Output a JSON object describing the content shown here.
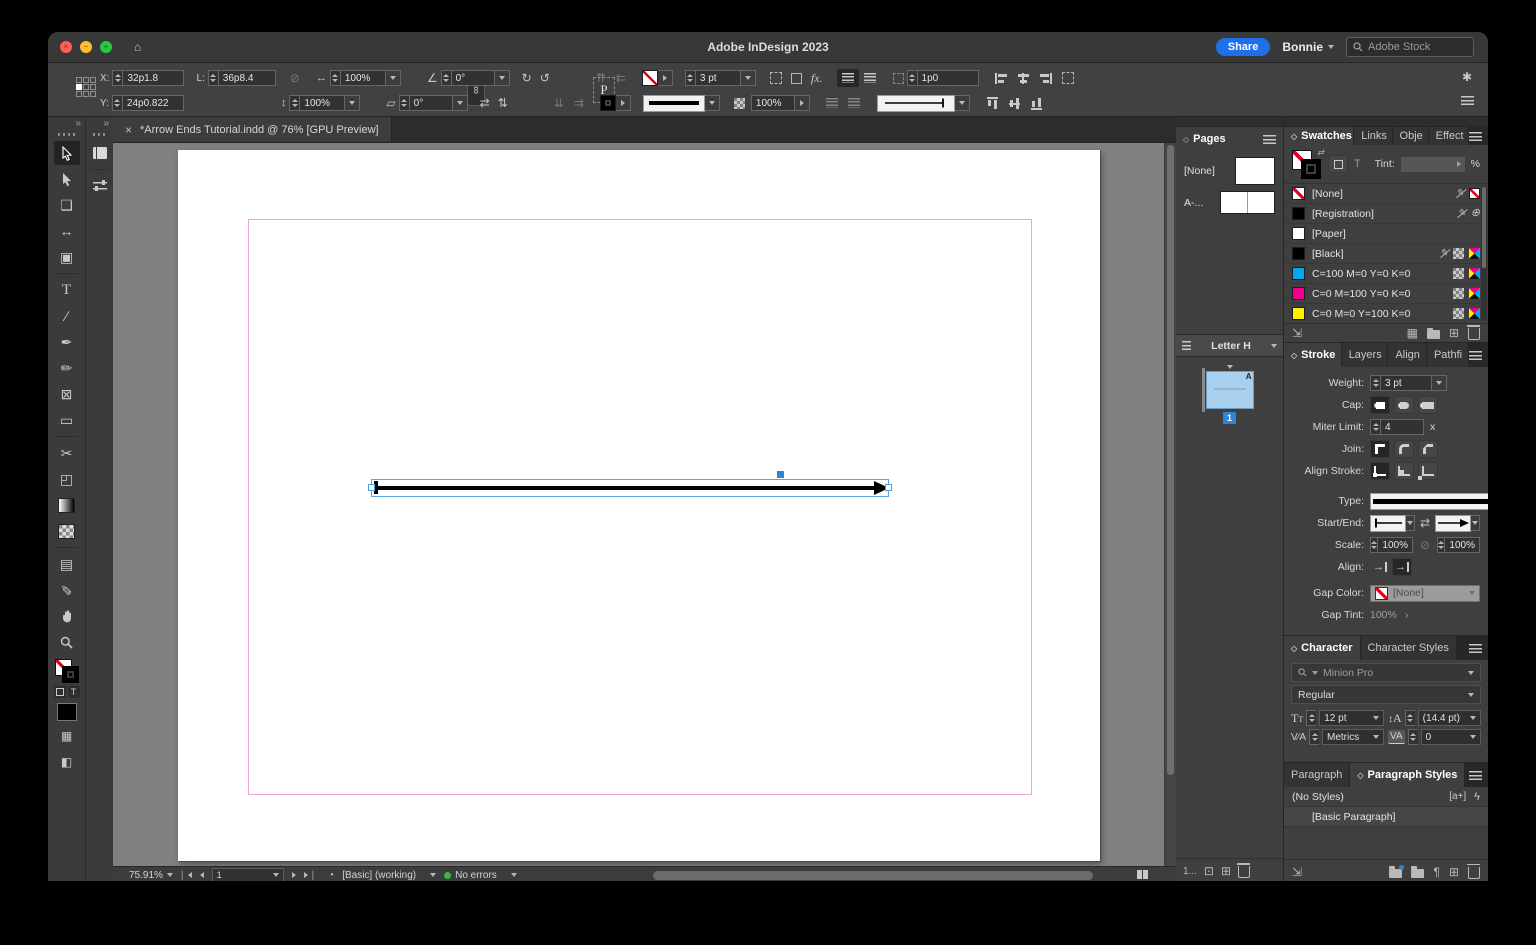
{
  "colors": {
    "accent_blue": "#1f6fe8",
    "selection_blue": "#4f9fe8",
    "margin_guide_pink": "#eba3d8",
    "error_green": "#3cb83c",
    "swatch_cyan": "#00a8ec",
    "swatch_magenta": "#ec008c",
    "swatch_yellow": "#ffef00"
  },
  "icons": {
    "home": "⌂",
    "collapse": "»",
    "panel_toggle": "◇",
    "rotate_cw": "↻",
    "rotate_ccw": "↺",
    "flip_h": "⇄",
    "flip_v": "⇅",
    "angle": "∠",
    "shear": "▱",
    "scale_h": "↔",
    "scale_v": "↕",
    "link": "∞",
    "broken_link": "⊘",
    "swap": "⇄",
    "pale_1": "⇈",
    "pale_2": "⇇",
    "pale_3": "⇊",
    "pale_4": "⇉",
    "gear": "✱",
    "more": "›",
    "tool_page": "❏",
    "tool_gap": "↔",
    "tool_collector": "▣",
    "tool_type": "T",
    "tool_line": "∕",
    "tool_pen": "✒",
    "tool_pencil": "✏",
    "tool_frame": "⊠",
    "tool_rect": "▭",
    "tool_scissors": "✂",
    "tool_freetransform": "◰",
    "tool_note": "▤",
    "tool_eyedropper": "✐",
    "tool_screenmode": "◧",
    "tool_viewopts": "▦",
    "registration": "⊕",
    "import": "⇲",
    "new_item": "⊞",
    "pilcrow": "¶",
    "bolt": "ϟ",
    "preflight": "◔",
    "fmt_text": "T"
  },
  "titlebar": {
    "title": "Adobe InDesign 2023",
    "share": "Share",
    "user": "Bonnie",
    "stock": "Adobe Stock"
  },
  "control": {
    "x_label": "X:",
    "x_value": "32p1.8",
    "y_label": "Y:",
    "y_value": "24p0.822",
    "l_label": "L:",
    "l_value": "36p8.4",
    "scale_w": "100%",
    "scale_h": "100%",
    "rotation": "0°",
    "shear": "0°",
    "p_label": "P",
    "weight": "3 pt",
    "fx": "fx.",
    "tint": "100%",
    "corner": "1p0"
  },
  "doc_tab": {
    "close": "×",
    "title": "*Arrow Ends Tutorial.indd @ 76% [GPU Preview]"
  },
  "pages": {
    "title": "Pages",
    "none_label": "[None]",
    "master_label": "A-...",
    "size_name": "Letter H",
    "badge": "A",
    "page_number": "1",
    "footer": "1..."
  },
  "swatches": {
    "title": "Swatches",
    "tab_links": "Links",
    "tab_object": "Obje",
    "tab_effects": "Effect",
    "tint_label": "Tint:",
    "percent": "%",
    "items": [
      {
        "name": "[None]"
      },
      {
        "name": "[Registration]"
      },
      {
        "name": "[Paper]"
      },
      {
        "name": "[Black]"
      },
      {
        "name": "C=100 M=0 Y=0 K=0",
        "hex": "#00a8ec"
      },
      {
        "name": "C=0 M=100 Y=0 K=0",
        "hex": "#ec008c"
      },
      {
        "name": "C=0 M=0 Y=100 K=0",
        "hex": "#ffef00"
      }
    ]
  },
  "stroke": {
    "title": "Stroke",
    "tab_layers": "Layers",
    "tab_align": "Align",
    "tab_pathfinder": "Pathfi",
    "weight_label": "Weight:",
    "weight_value": "3 pt",
    "cap_label": "Cap:",
    "miter_label": "Miter Limit:",
    "miter_value": "4",
    "miter_suffix": "x",
    "join_label": "Join:",
    "align_stroke_label": "Align Stroke:",
    "type_label": "Type:",
    "startend_label": "Start/End:",
    "scale_label": "Scale:",
    "scale_start": "100%",
    "scale_end": "100%",
    "align_label": "Align:",
    "gap_color_label": "Gap Color:",
    "gap_color_value": "[None]",
    "gap_tint_label": "Gap Tint:",
    "gap_tint_value": "100%"
  },
  "character": {
    "title": "Character",
    "tab_styles": "Character Styles",
    "font_name": "Minion Pro",
    "font_style": "Regular",
    "size_value": "12 pt",
    "leading_value": "(14.4 pt)",
    "kerning_value": "Metrics",
    "tracking_value": "0"
  },
  "paragraph": {
    "tab_paragraph": "Paragraph",
    "tab_styles": "Paragraph Styles",
    "no_styles": "(No Styles)",
    "badge": "[a+]",
    "basic": "[Basic Paragraph]"
  },
  "statusbar": {
    "zoom": "75.91%",
    "page_value": "1",
    "profile": "[Basic] (working)",
    "errors": "No errors"
  }
}
